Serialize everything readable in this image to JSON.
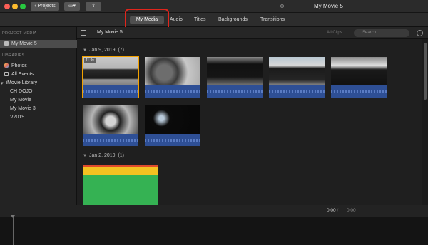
{
  "window": {
    "title": "My Movie 5"
  },
  "toolbar": {
    "projects_label": "Projects"
  },
  "tabs": [
    {
      "label": "My Media",
      "active": true
    },
    {
      "label": "Audio"
    },
    {
      "label": "Titles"
    },
    {
      "label": "Backgrounds"
    },
    {
      "label": "Transitions"
    }
  ],
  "sidebar": {
    "project_media_header": "PROJECT MEDIA",
    "project": "My Movie 5",
    "libraries_header": "LIBRARIES",
    "items": [
      "Photos",
      "All Events",
      "iMovie Library",
      "CH DOJO",
      "My Movie",
      "My Movie 3",
      "V2019"
    ]
  },
  "browser": {
    "title": "My Movie 5",
    "filter": "All Clips",
    "search_placeholder": "Search",
    "events": [
      {
        "date": "Jan 9, 2019",
        "count": "(7)",
        "first_clip_duration": "11.9s"
      },
      {
        "date": "Jan 2, 2019",
        "count": "(1)"
      }
    ]
  },
  "timeline": {
    "current": "0:00",
    "separator": "/",
    "total": "0:00"
  },
  "colors": {
    "highlight": "#e0251c",
    "waveform": "#2e4f95",
    "selection": "#f2a100"
  }
}
